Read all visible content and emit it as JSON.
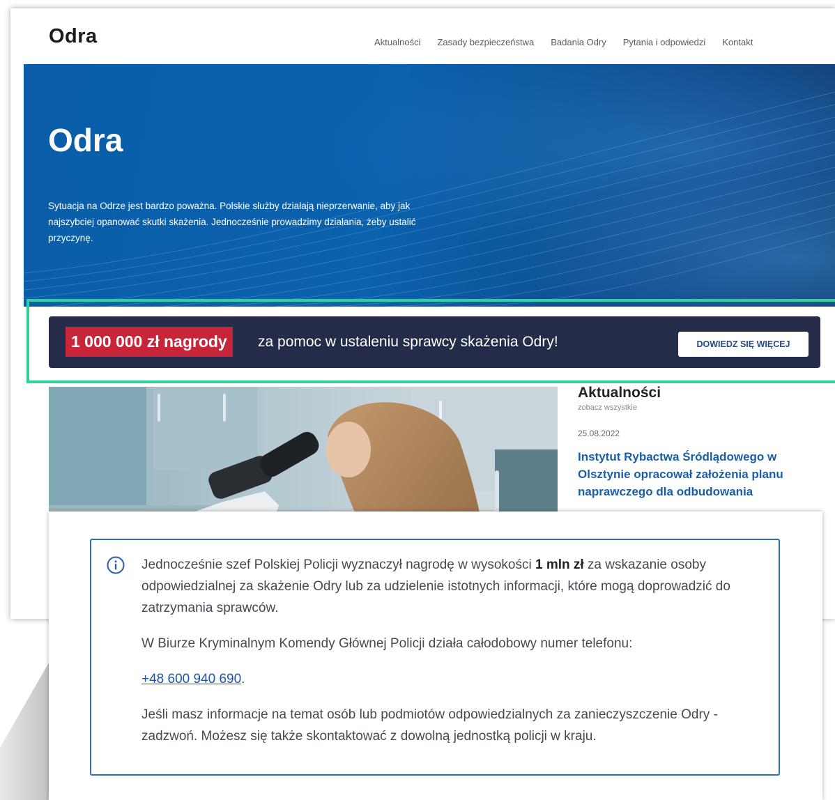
{
  "colors": {
    "hero_blue": "#0b62ad",
    "banner_navy": "#242c4a",
    "badge_red": "#c9253a",
    "highlight_green": "#2ed39b",
    "link_blue": "#1a5fa8",
    "info_border": "#2f6fb6"
  },
  "site": {
    "logo": "Odra"
  },
  "nav": {
    "items": [
      "Aktualności",
      "Zasady bezpieczeństwa",
      "Badania Odry",
      "Pytania i odpowiedzi",
      "Kontakt"
    ]
  },
  "hero": {
    "title": "Odra",
    "text": "Sytuacja na Odrze jest bardzo poważna. Polskie służby działają nieprzerwanie, aby jak najszybciej opanować skutki skażenia. Jednocześnie prowadzimy działania, żeby ustalić przyczynę."
  },
  "banner": {
    "badge": "1 000 000 zł nagrody",
    "text": "za pomoc w ustaleniu sprawcy skażenia Odry!",
    "button": "DOWIEDZ SIĘ WIĘCEJ"
  },
  "news": {
    "title": "Aktualności",
    "see_all": "zobacz wszystkie",
    "date": "25.08.2022",
    "headline": "Instytut Rybactwa Śródlądowego w Olsztynie opracował założenia planu naprawczego dla odbudowania"
  },
  "info": {
    "icon": "info-icon",
    "p1_before": "Jednocześnie szef Polskiej Policji wyznaczył nagrodę w wysokości ",
    "p1_bold": "1 mln zł",
    "p1_after": " za wskazanie osoby odpowiedzialnej za skażenie Odry lub za udzielenie istotnych informacji, które mogą doprowadzić do zatrzymania sprawców.",
    "p2": "W Biurze Kryminalnym Komendy Głównej Policji działa całodobowy numer telefonu:",
    "phone": "+48 600 940 690",
    "phone_suffix": ".",
    "p3": "Jeśli masz informacje na temat osób lub podmiotów odpowiedzialnych za zanieczyszczenie Odry - zadzwoń. Możesz się także skontaktować z dowolną jednostką policji w kraju."
  }
}
